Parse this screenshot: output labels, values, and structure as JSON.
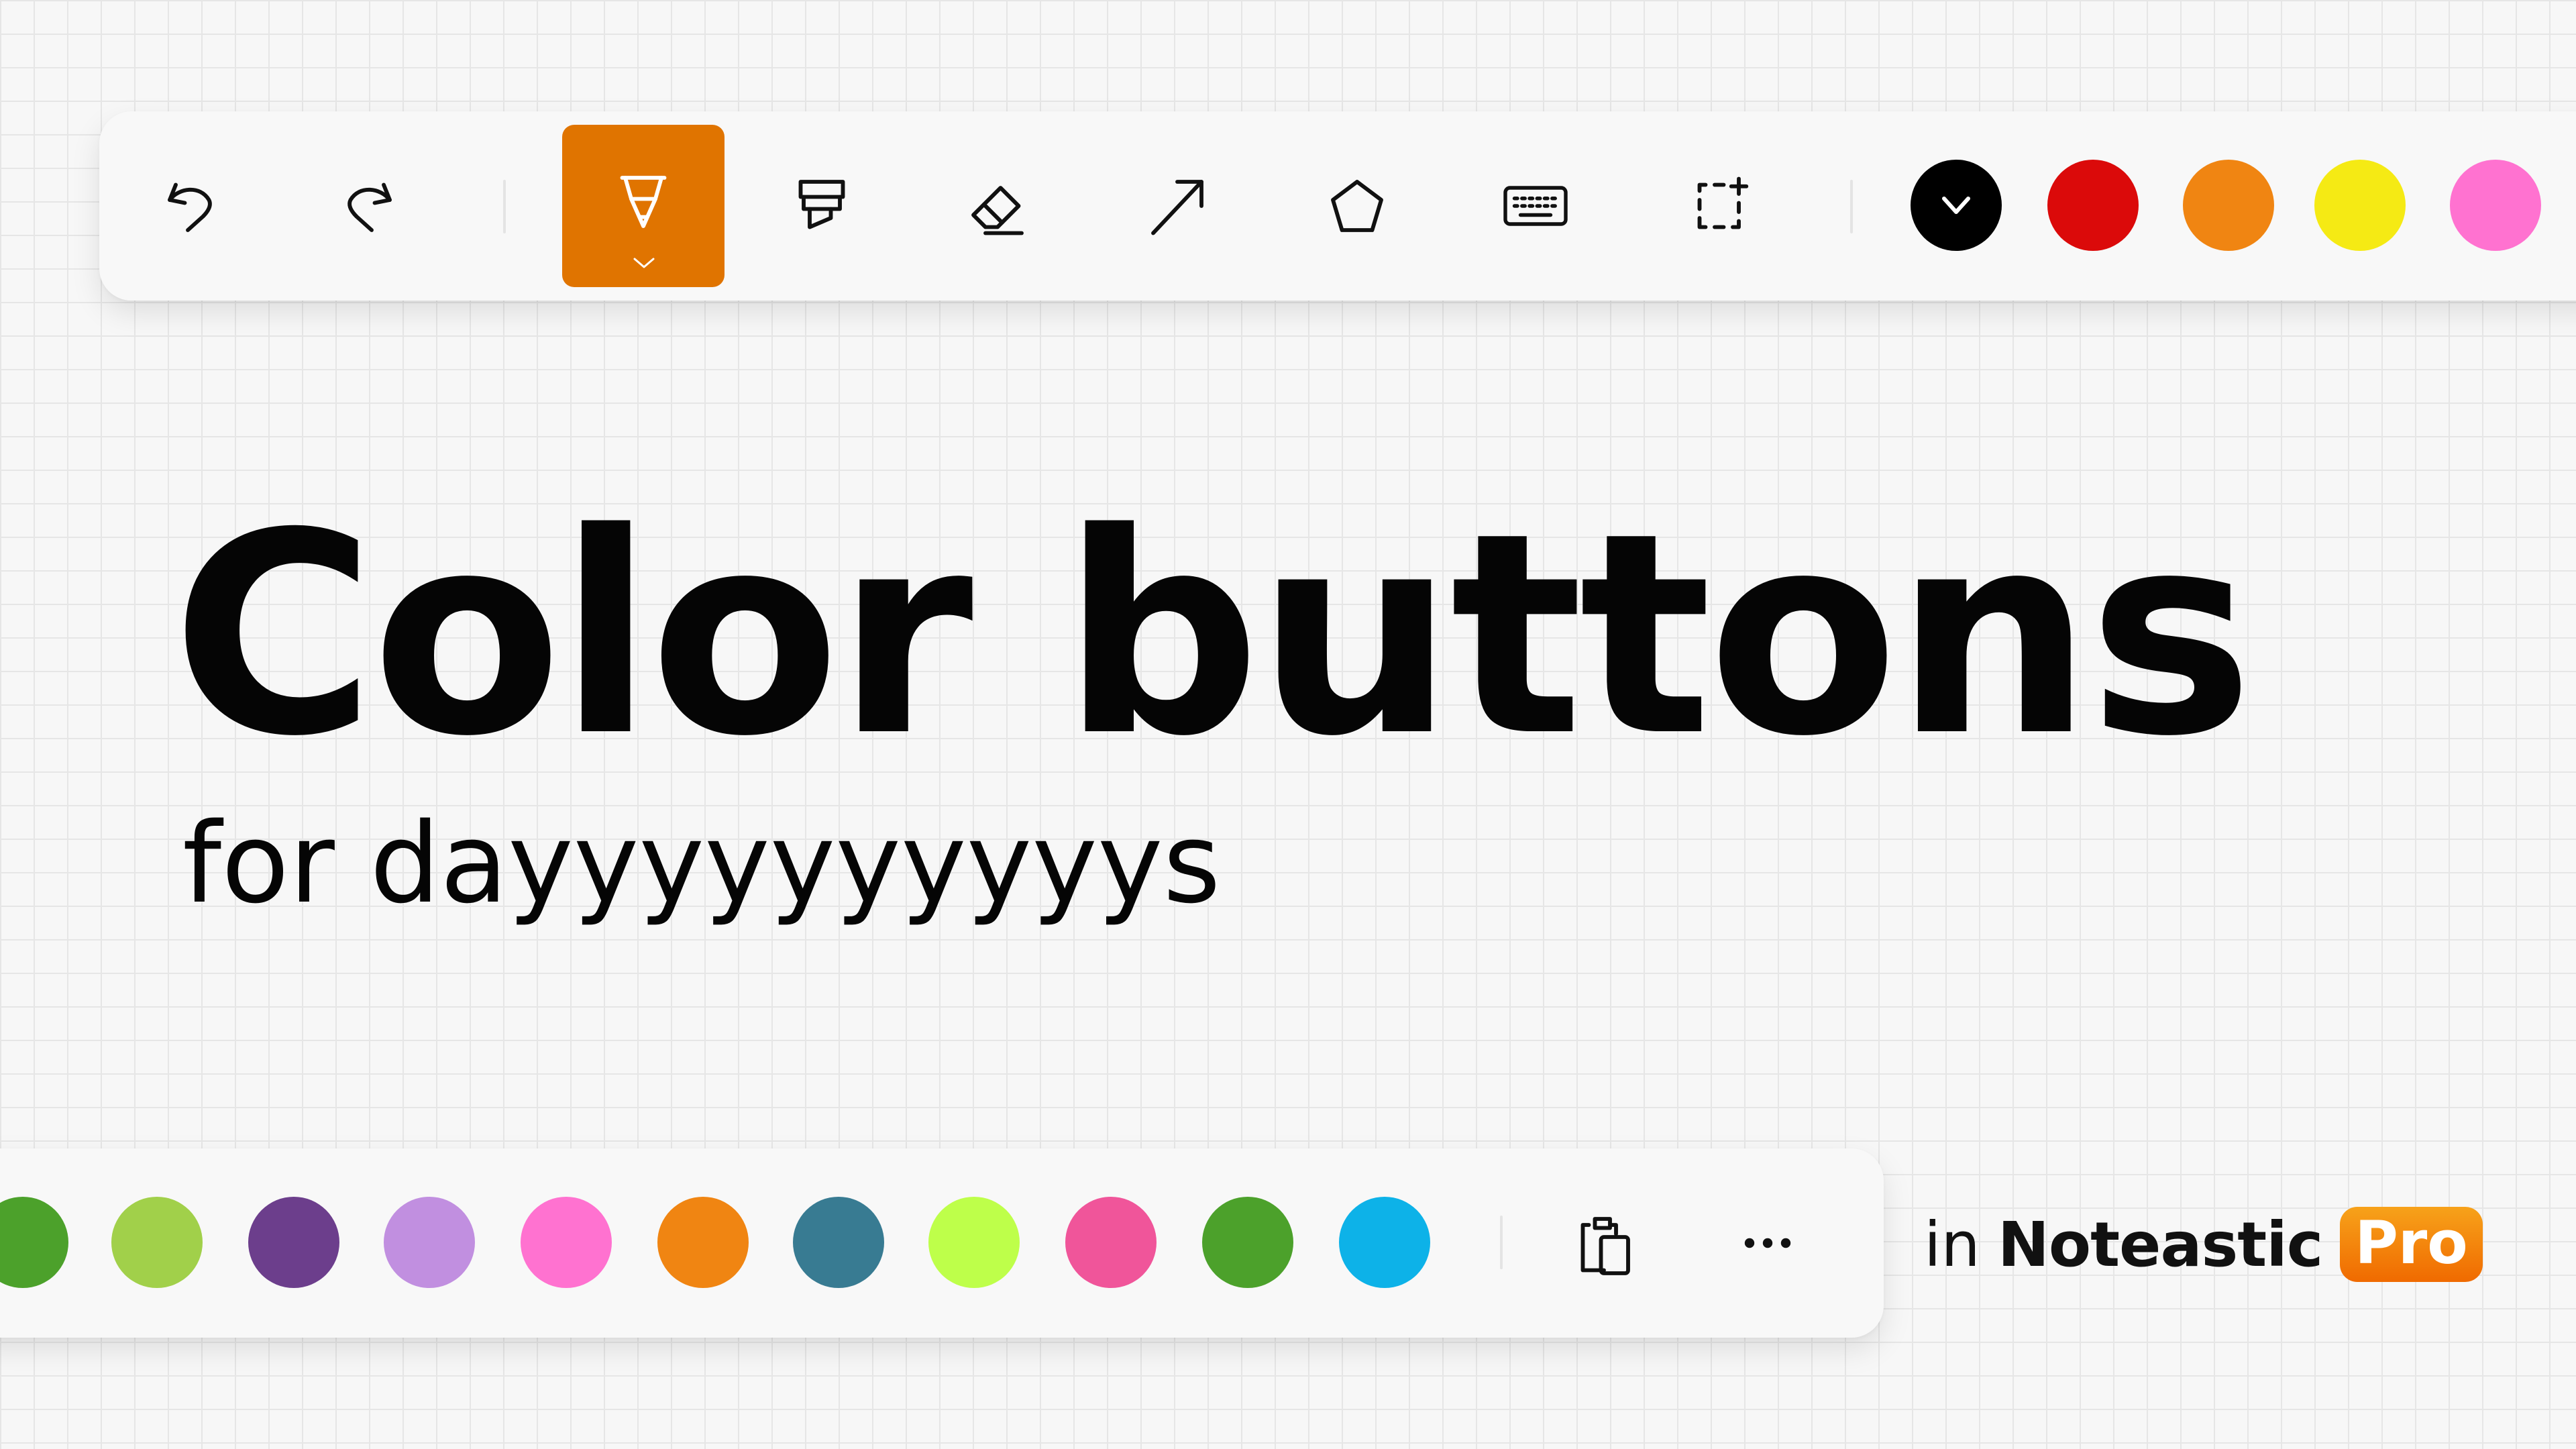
{
  "toolbar_top": {
    "tools": [
      {
        "name": "undo-icon",
        "label": "Undo"
      },
      {
        "name": "redo-icon",
        "label": "Redo"
      },
      {
        "name": "pen-icon",
        "label": "Pen",
        "active": true
      },
      {
        "name": "highlighter-icon",
        "label": "Highlighter"
      },
      {
        "name": "eraser-icon",
        "label": "Eraser"
      },
      {
        "name": "arrow-icon",
        "label": "Arrow"
      },
      {
        "name": "shape-icon",
        "label": "Shape"
      },
      {
        "name": "keyboard-icon",
        "label": "Text"
      },
      {
        "name": "lasso-select-icon",
        "label": "Select"
      }
    ],
    "active_tool_color": "#E07400",
    "colors": [
      {
        "name": "black",
        "hex": "#000000",
        "selected": true
      },
      {
        "name": "red",
        "hex": "#DB0A0A"
      },
      {
        "name": "orange",
        "hex": "#F08512"
      },
      {
        "name": "yellow",
        "hex": "#F5EA14"
      },
      {
        "name": "pink",
        "hex": "#FF72D0"
      }
    ]
  },
  "toolbar_bottom": {
    "colors": [
      {
        "name": "green-partial",
        "hex": "#4CA12B"
      },
      {
        "name": "lime",
        "hex": "#A1D04A"
      },
      {
        "name": "purple",
        "hex": "#6C3E8C"
      },
      {
        "name": "lavender",
        "hex": "#C18FE0"
      },
      {
        "name": "pink",
        "hex": "#FF72D0"
      },
      {
        "name": "orange",
        "hex": "#F08512"
      },
      {
        "name": "teal",
        "hex": "#387B92"
      },
      {
        "name": "yellow-green",
        "hex": "#BEFF4A"
      },
      {
        "name": "rose",
        "hex": "#F0559A"
      },
      {
        "name": "green",
        "hex": "#4CA12B"
      },
      {
        "name": "sky-blue",
        "hex": "#0DB2E8"
      }
    ],
    "actions": [
      {
        "name": "clipboard-icon",
        "label": "Paste"
      },
      {
        "name": "more-icon",
        "label": "More"
      }
    ]
  },
  "headline": "Color buttons",
  "subtitle": "for dayyyyyyyyyys",
  "brand": {
    "prefix": "in",
    "name": "Noteastic",
    "badge": "Pro"
  }
}
